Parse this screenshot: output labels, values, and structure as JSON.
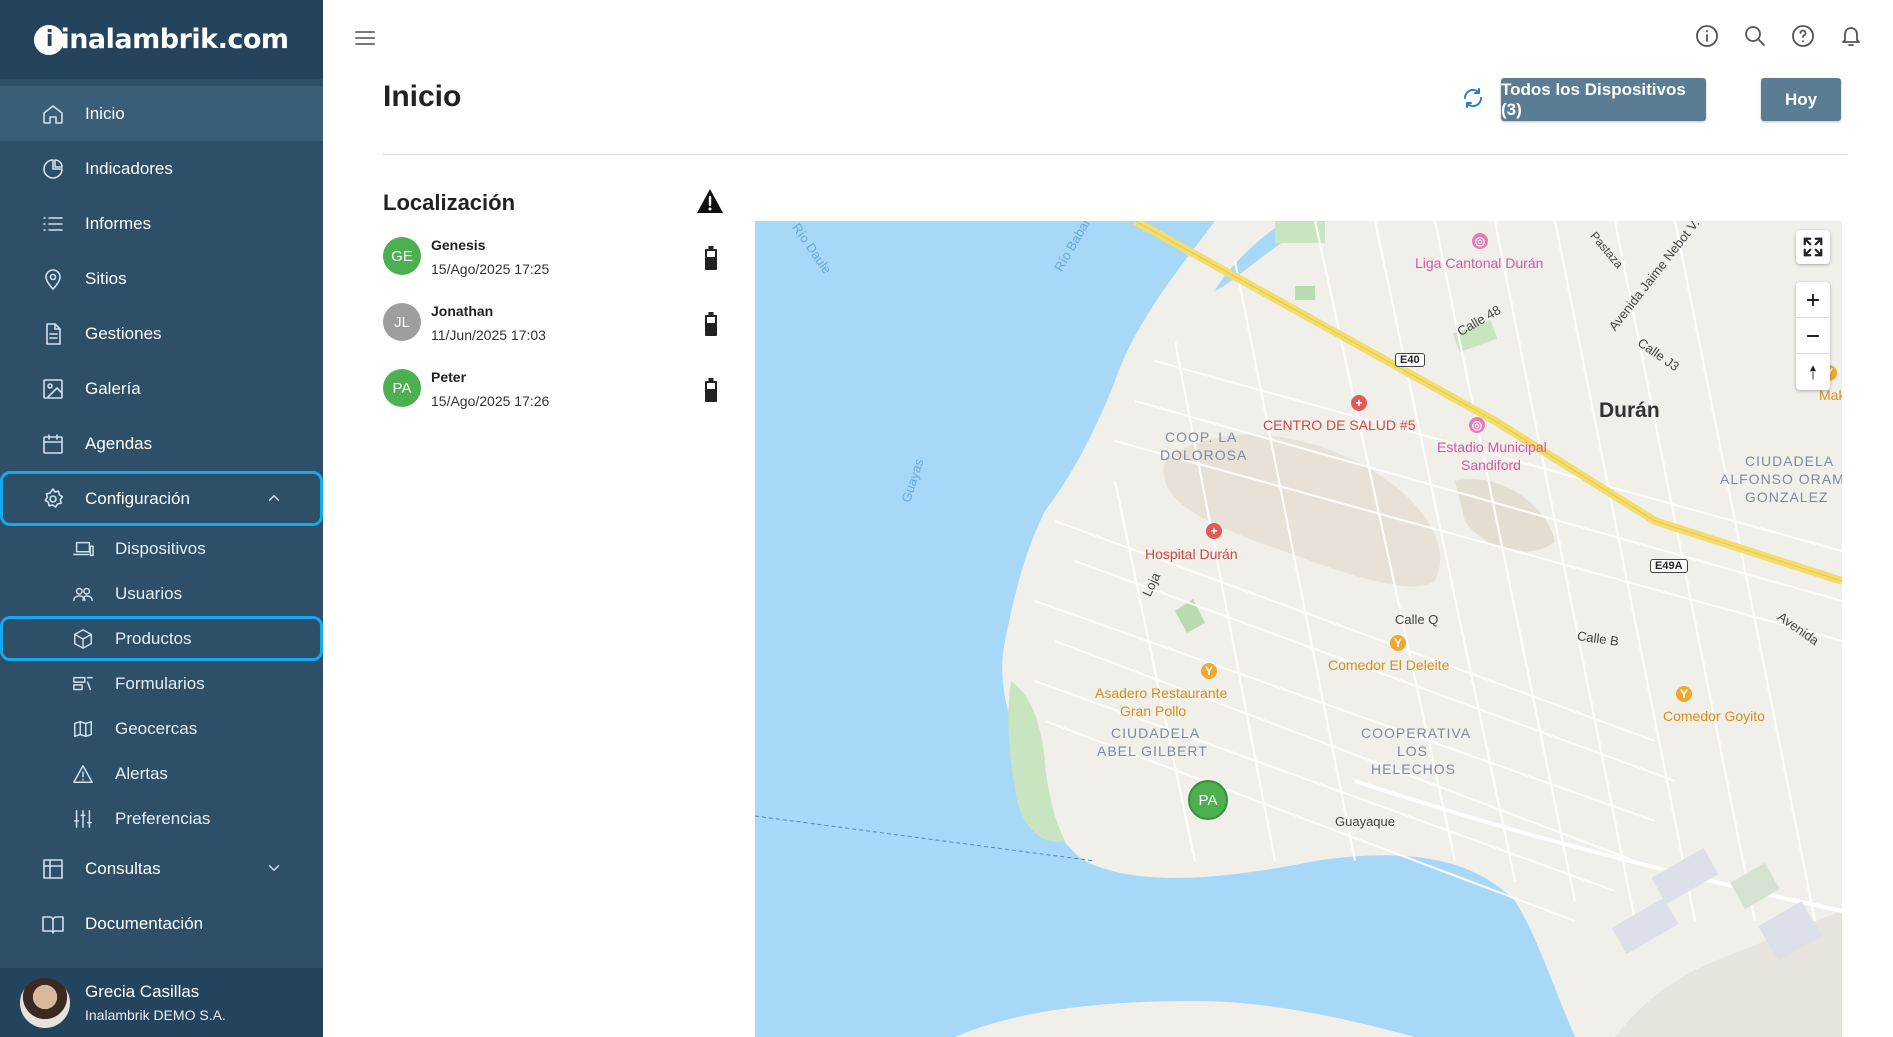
{
  "brand": {
    "logo_text": "inalambrik.com",
    "logo_mark": "i"
  },
  "sidebar": {
    "items": [
      {
        "label": "Inicio",
        "icon": "home-icon"
      },
      {
        "label": "Indicadores",
        "icon": "pie-chart-icon"
      },
      {
        "label": "Informes",
        "icon": "list-icon"
      },
      {
        "label": "Sitios",
        "icon": "location-pin-icon"
      },
      {
        "label": "Gestiones",
        "icon": "document-icon"
      },
      {
        "label": "Galería",
        "icon": "image-icon"
      },
      {
        "label": "Agendas",
        "icon": "calendar-icon"
      },
      {
        "label": "Configuración",
        "icon": "gear-icon"
      },
      {
        "label": "Consultas",
        "icon": "table-icon"
      },
      {
        "label": "Documentación",
        "icon": "book-icon"
      }
    ],
    "sub_items": [
      {
        "label": "Dispositivos",
        "icon": "devices-icon"
      },
      {
        "label": "Usuarios",
        "icon": "users-icon"
      },
      {
        "label": "Productos",
        "icon": "box-icon"
      },
      {
        "label": "Formularios",
        "icon": "form-icon"
      },
      {
        "label": "Geocercas",
        "icon": "map-icon"
      },
      {
        "label": "Alertas",
        "icon": "warning-icon"
      },
      {
        "label": "Preferencias",
        "icon": "sliders-icon"
      }
    ],
    "user": {
      "name": "Grecia Casillas",
      "org": "Inalambrik DEMO S.A."
    }
  },
  "header": {
    "title": "Inicio",
    "devices_button": "Todos los Dispositivos (3)",
    "today_button": "Hoy"
  },
  "location": {
    "title": "Localización",
    "devices": [
      {
        "initials": "GE",
        "name": "Genesis",
        "time": "15/Ago/2025 17:25",
        "color": "#4caf50"
      },
      {
        "initials": "JL",
        "name": "Jonathan",
        "time": "11/Jun/2025 17:03",
        "color": "#9e9e9e"
      },
      {
        "initials": "PA",
        "name": "Peter",
        "time": "15/Ago/2025 17:26",
        "color": "#4caf50"
      }
    ]
  },
  "map": {
    "marker": "PA",
    "labels": {
      "duran": "Durán",
      "rio_daule": "Río Daule",
      "rio_babahoyo": "Río Babahoyo",
      "guayas": "Guayas",
      "liga": "Liga Cantonal Durán",
      "pastaza": "Pastaza",
      "avenida_jaime": "Avenida Jaime Nebot V.",
      "calle48": "Calle 48",
      "callej3": "Calle J3",
      "e40": "E40",
      "centro_salud": "CENTRO DE SALUD #5",
      "estadio": "Estadio Municipal",
      "estadio2": "Sandiford",
      "coop_dolorosa1": "COOP. LA",
      "coop_dolorosa2": "DOLOROSA",
      "ciudadela_alfonso1": "CIUDADELA",
      "ciudadela_alfonso2": "ALFONSO ORAMA",
      "ciudadela_alfonso3": "GONZALEZ",
      "hospital": "Hospital Durán",
      "loja": "Loja",
      "e49a": "E49A",
      "avenida": "Avenida",
      "calleq": "Calle Q",
      "calleb": "Calle B",
      "comedor_deleite": "Comedor El Deleite",
      "asadero1": "Asadero Restaurante",
      "asadero2": "Gran Pollo",
      "ciudadela_abel1": "CIUDADELA",
      "ciudadela_abel2": "ABEL GILBERT",
      "coop_helechos1": "COOPERATIVA",
      "coop_helechos2": "LOS",
      "coop_helechos3": "HELECHOS",
      "comedor_goyito": "Comedor Goyito",
      "guayaque": "Guayaque",
      "maka": "Maka"
    },
    "colors": {
      "water": "#a8d8f8",
      "land": "#f1efe9",
      "road_major": "#f3dd6d",
      "park": "#c9e4c0"
    }
  }
}
